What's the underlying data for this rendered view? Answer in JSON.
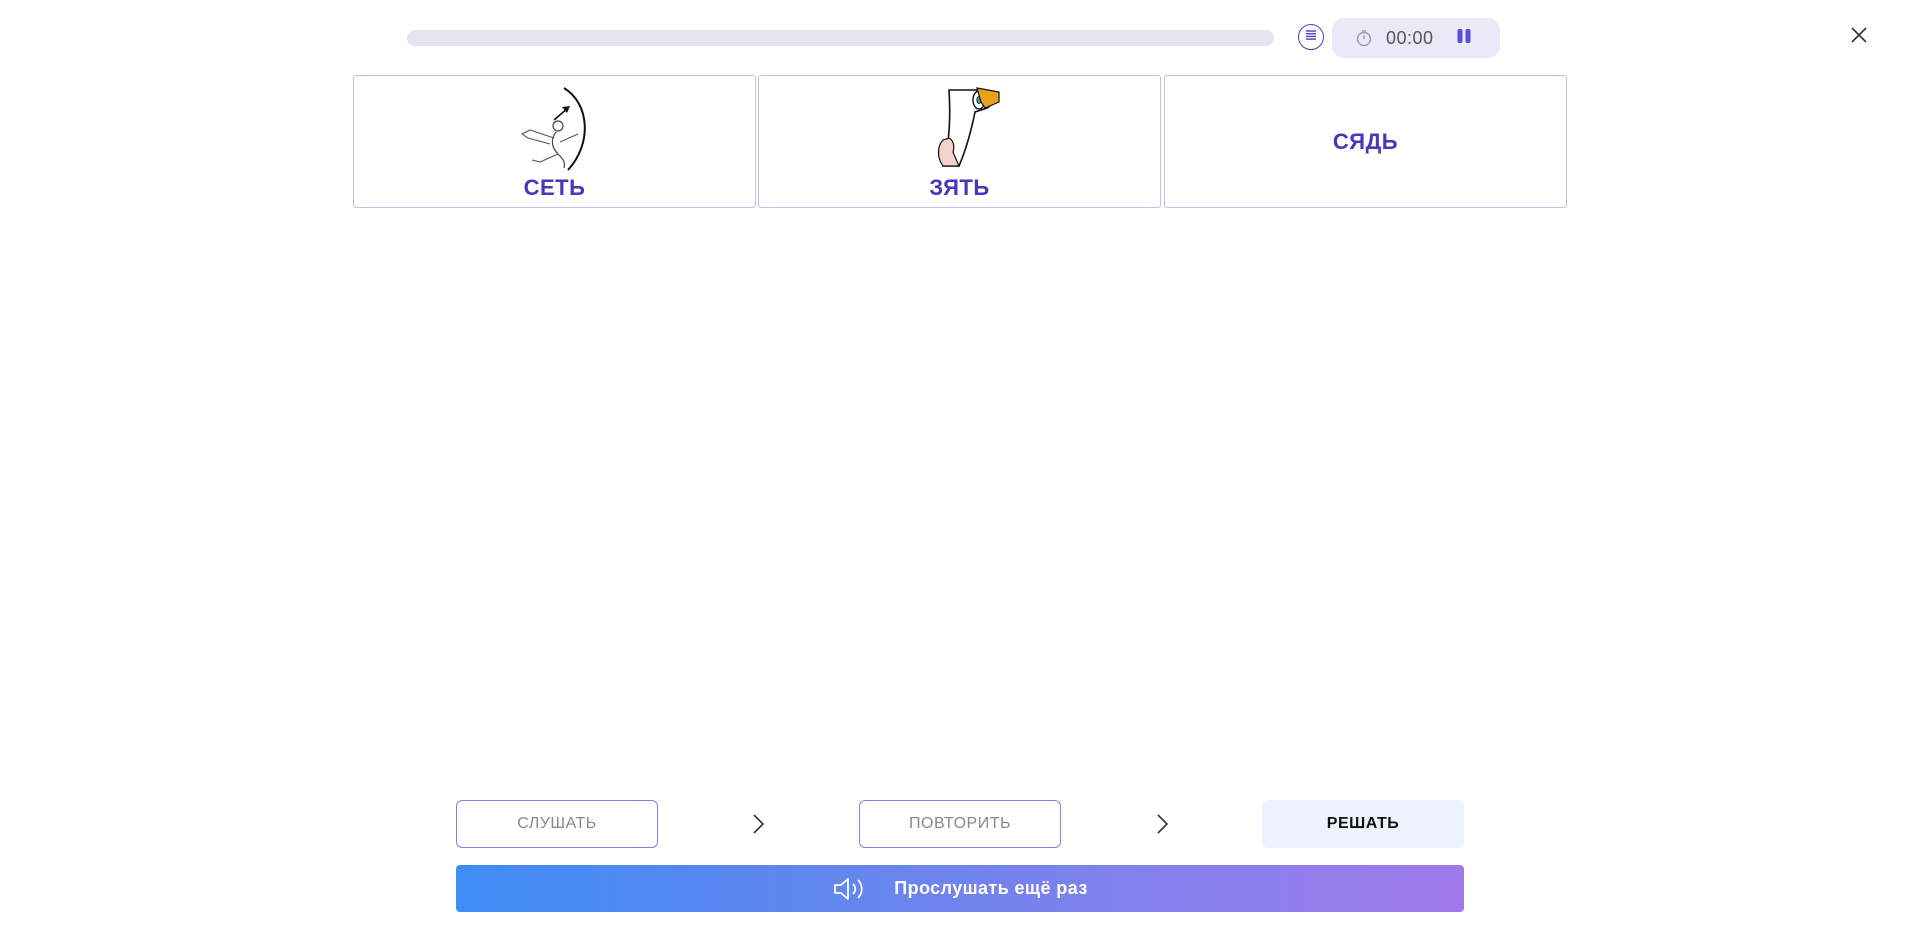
{
  "header": {
    "progress": 0,
    "timer": "00:00",
    "icons": {
      "menu": "list-icon",
      "clock": "stopwatch-icon",
      "pause": "pause-icon",
      "close": "close-icon"
    }
  },
  "cards": [
    {
      "word": "СЕТЬ",
      "image": "archer-drawing"
    },
    {
      "word": "ЗЯТЬ",
      "image": "hand-toilet-paper-drawing"
    },
    {
      "word": "СЯДЬ",
      "image": ""
    }
  ],
  "steps": {
    "listen": "СЛУШАТЬ",
    "repeat": "ПОВТОРИТЬ",
    "solve": "РЕШАТЬ"
  },
  "listen_again": {
    "label": "Прослушать ещё раз",
    "icon": "speaker-icon"
  },
  "colors": {
    "accent": "#4b35b8",
    "card_border": "#c3bdf0",
    "gradient_start": "#3f8cf5",
    "gradient_end": "#a07aea",
    "solve_bg": "#edf2fc"
  }
}
